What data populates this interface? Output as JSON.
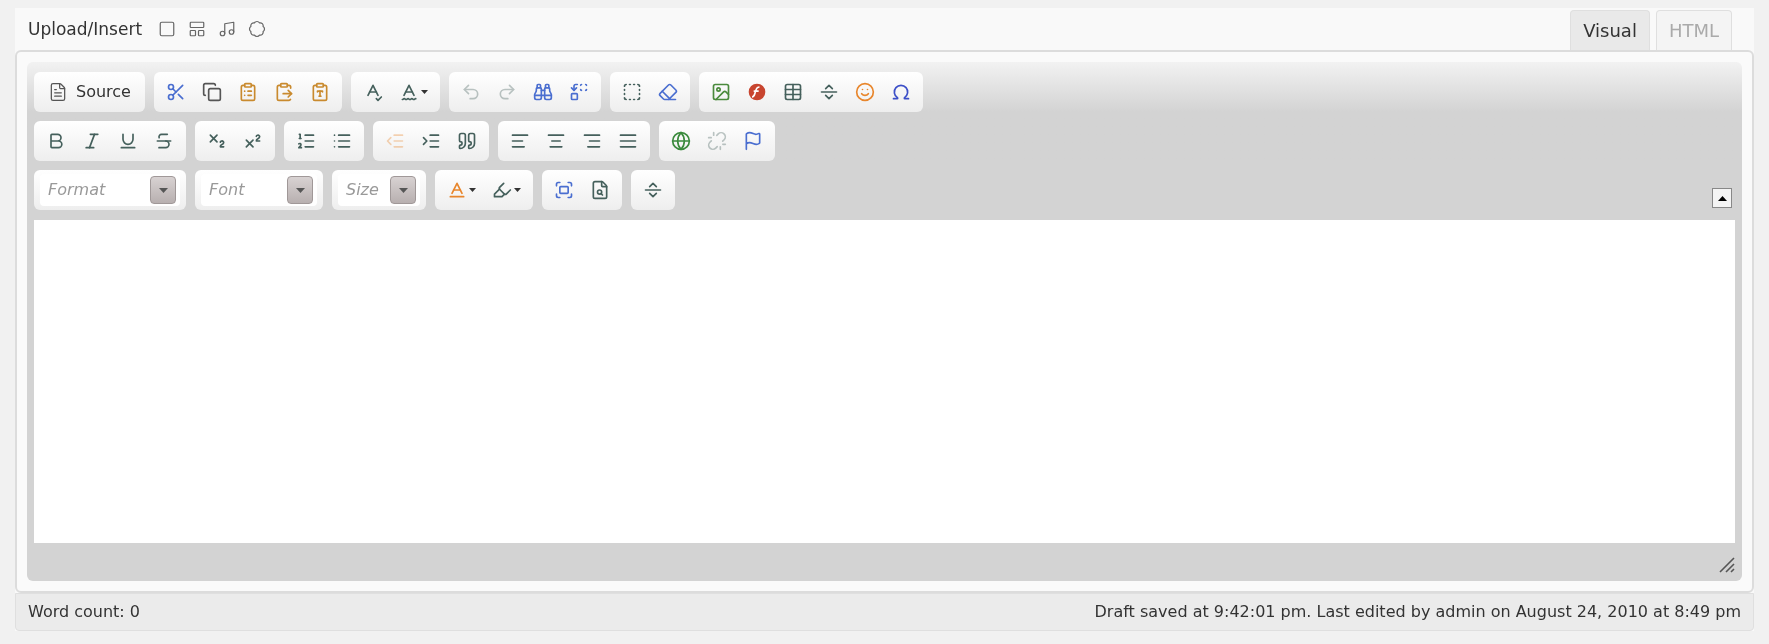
{
  "media_bar": {
    "label": "Upload/Insert",
    "buttons": [
      {
        "kind": "icon"
      },
      {
        "kind": "icon"
      },
      {
        "kind": "icon"
      },
      {
        "kind": "icon"
      }
    ]
  },
  "tabs": [
    {
      "label": "Visual",
      "selected": true
    },
    {
      "label": "HTML",
      "selected": false
    }
  ],
  "toolbar": {
    "rows": [
      [
        [
          {
            "kind": "label",
            "label": "Source",
            "disabled": false
          }
        ],
        [
          {
            "kind": "icon",
            "disabled": false
          },
          {
            "kind": "icon",
            "disabled": false
          },
          {
            "kind": "icon",
            "disabled": false
          },
          {
            "kind": "icon",
            "disabled": false
          },
          {
            "kind": "icon",
            "disabled": false
          }
        ],
        [
          {
            "kind": "icon",
            "disabled": false
          },
          {
            "kind": "icon",
            "disabled": false,
            "dropdown": true
          }
        ],
        [
          {
            "kind": "icon",
            "disabled": true
          },
          {
            "kind": "icon",
            "disabled": true
          },
          {
            "kind": "icon",
            "disabled": false
          },
          {
            "kind": "icon",
            "disabled": false
          }
        ],
        [
          {
            "kind": "icon",
            "disabled": false
          },
          {
            "kind": "icon",
            "disabled": false
          }
        ],
        [
          {
            "kind": "icon",
            "disabled": false
          },
          {
            "kind": "icon",
            "disabled": false
          },
          {
            "kind": "icon",
            "disabled": false
          },
          {
            "kind": "icon",
            "disabled": false
          },
          {
            "kind": "icon",
            "disabled": false
          },
          {
            "kind": "icon",
            "disabled": false
          }
        ]
      ],
      [
        [
          {
            "kind": "icon",
            "disabled": false
          },
          {
            "kind": "icon",
            "disabled": false
          },
          {
            "kind": "icon",
            "disabled": false
          },
          {
            "kind": "icon",
            "disabled": false
          }
        ],
        [
          {
            "kind": "icon",
            "disabled": false
          },
          {
            "kind": "icon",
            "disabled": false
          }
        ],
        [
          {
            "kind": "icon",
            "disabled": false
          },
          {
            "kind": "icon",
            "disabled": false
          }
        ],
        [
          {
            "kind": "icon",
            "disabled": true
          },
          {
            "kind": "icon",
            "disabled": false
          },
          {
            "kind": "icon",
            "disabled": false
          }
        ],
        [
          {
            "kind": "icon",
            "disabled": false
          },
          {
            "kind": "icon",
            "disabled": false
          },
          {
            "kind": "icon",
            "disabled": false
          },
          {
            "kind": "icon",
            "disabled": false
          }
        ],
        [
          {
            "kind": "icon",
            "disabled": false
          },
          {
            "kind": "icon",
            "disabled": true
          },
          {
            "kind": "icon",
            "disabled": false
          }
        ]
      ],
      [
        [
          {
            "kind": "combo",
            "placeholder": "Format"
          }
        ],
        [
          {
            "kind": "combo",
            "placeholder": "Font"
          }
        ],
        [
          {
            "kind": "combo",
            "placeholder": "Size"
          }
        ],
        [
          {
            "kind": "icon",
            "disabled": false,
            "dropdown": true
          },
          {
            "kind": "icon",
            "disabled": false,
            "dropdown": true
          }
        ],
        [
          {
            "kind": "icon",
            "disabled": false
          },
          {
            "kind": "icon",
            "disabled": false
          }
        ],
        [
          {
            "kind": "icon",
            "disabled": false
          }
        ]
      ]
    ]
  },
  "status_bar": {
    "word_count": "Word count: 0",
    "draft_status": "Draft saved at 9:42:01 pm. Last edited by admin on August 24, 2010 at 8:49 pm"
  }
}
